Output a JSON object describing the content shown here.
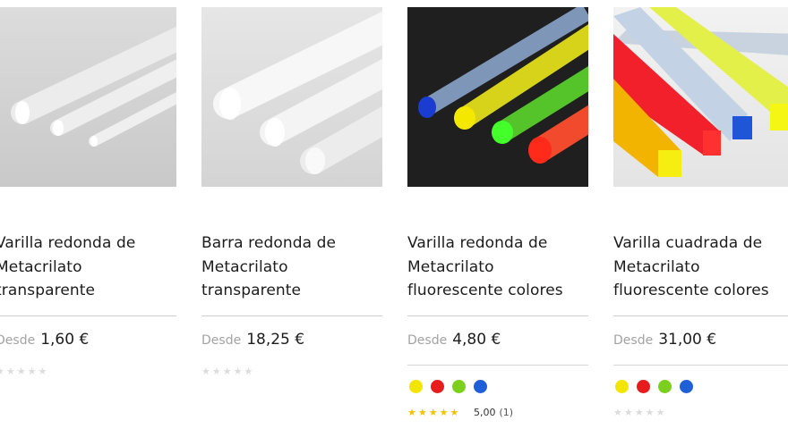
{
  "products": [
    {
      "title_lines": [
        "Varilla redonda de",
        "Metacrilato",
        "transparente"
      ],
      "price_prefix": "Desde",
      "price": "1,60 €",
      "rating_stars": "★★★★★"
    },
    {
      "title_lines": [
        "Barra redonda de",
        "Metacrilato",
        "transparente"
      ],
      "price_prefix": "Desde",
      "price": "18,25 €",
      "rating_stars": "★★★★★"
    },
    {
      "title_lines": [
        "Varilla redonda de",
        "Metacrilato",
        "fluorescente colores"
      ],
      "price_prefix": "Desde",
      "price": "4,80 €",
      "swatches": [
        "#f2e600",
        "#e81c1c",
        "#7ccf1c",
        "#1f5fd8"
      ],
      "rating_stars": "★★★★★",
      "rating_value": "5,00",
      "rating_count": "(1)"
    },
    {
      "title_lines": [
        "Varilla cuadrada de",
        "Metacrilato",
        "fluorescente colores"
      ],
      "price_prefix": "Desde",
      "price": "31,00 €",
      "swatches": [
        "#f2e600",
        "#e81c1c",
        "#7ccf1c",
        "#1f5fd8"
      ],
      "rating_stars": "★★★★★"
    }
  ]
}
